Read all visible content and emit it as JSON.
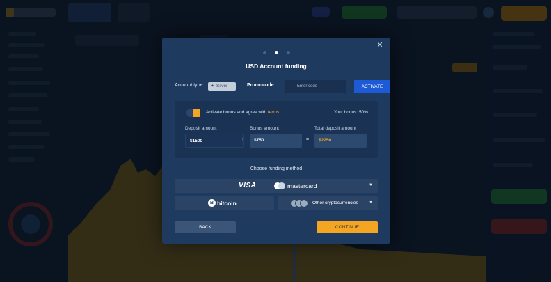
{
  "modal": {
    "title": "USD Account funding",
    "steps": [
      false,
      true,
      false
    ],
    "close_icon": "close-icon"
  },
  "account": {
    "type_label": "Account type:",
    "type_value": "Silver",
    "promocode_label": "Promocode",
    "promocode_placeholder": "Enter code",
    "activate_label": "ACTIVATE"
  },
  "bonus": {
    "toggle_on": true,
    "text": "Activate bonus and agree with",
    "terms_link": "terms",
    "your_bonus": "Your bonus: 50%"
  },
  "amounts": {
    "deposit_label": "Deposit amount",
    "deposit_value": "$1500",
    "bonus_label": "Bonus amount",
    "bonus_value": "$750",
    "total_label": "Total deposit amount",
    "total_value": "$2250",
    "plus": "+",
    "equals": "="
  },
  "funding": {
    "heading": "Choose funding method",
    "cards_visa": "VISA",
    "cards_mastercard": "mastercard",
    "bitcoin": "bitcoin",
    "bitcoin_symbol": "B",
    "other_crypto": "Other cryptocurrencies"
  },
  "actions": {
    "back_label": "BACK",
    "continue_label": "CONTINUE"
  },
  "colors": {
    "accent": "#f4a623",
    "primary_blue": "#1d5bd6",
    "modal_bg": "#1e3a5f"
  }
}
